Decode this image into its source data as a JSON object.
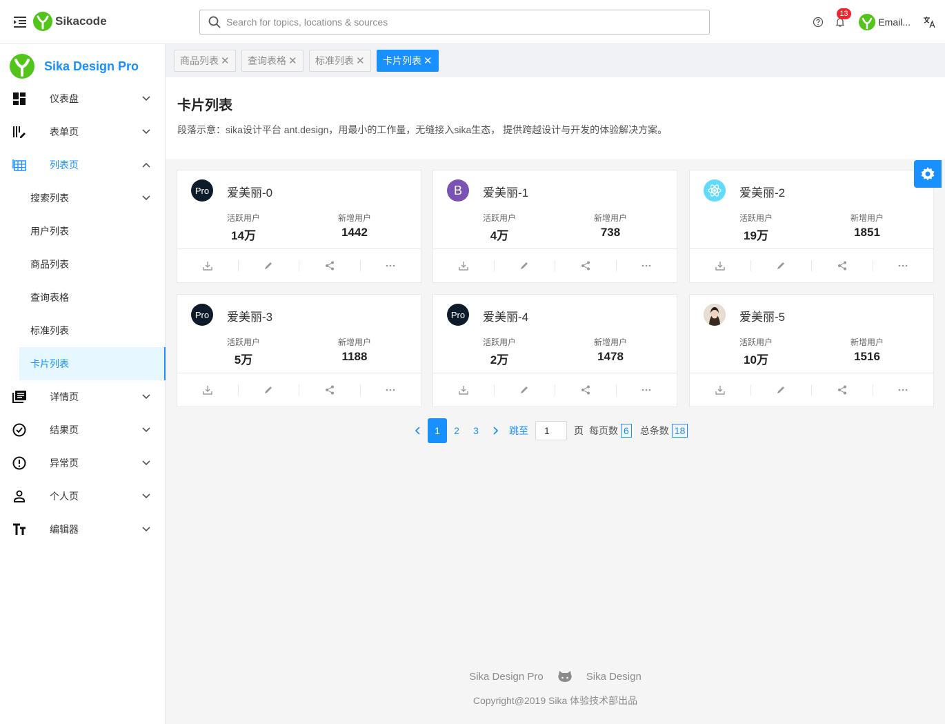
{
  "header": {
    "brand": "Sikacode",
    "search_placeholder": "Search for topics, locations & sources",
    "notification_count": "13",
    "user_name": "Email..."
  },
  "sidebar": {
    "title": "Sika Design Pro",
    "items": [
      {
        "label": "仪表盘",
        "icon": "dashboard-icon"
      },
      {
        "label": "表单页",
        "icon": "form-icon"
      },
      {
        "label": "列表页",
        "icon": "table-icon"
      },
      {
        "label": "详情页",
        "icon": "profile-icon"
      },
      {
        "label": "结果页",
        "icon": "check-circle-icon"
      },
      {
        "label": "异常页",
        "icon": "warning-icon"
      },
      {
        "label": "个人页",
        "icon": "user-icon"
      },
      {
        "label": "编辑器",
        "icon": "font-size-icon"
      }
    ],
    "sub_items": [
      {
        "label": "搜索列表"
      },
      {
        "label": "用户列表"
      },
      {
        "label": "商品列表"
      },
      {
        "label": "查询表格"
      },
      {
        "label": "标准列表"
      },
      {
        "label": "卡片列表"
      }
    ]
  },
  "tabs": [
    {
      "label": "商品列表"
    },
    {
      "label": "查询表格"
    },
    {
      "label": "标准列表"
    },
    {
      "label": "卡片列表"
    }
  ],
  "page": {
    "title": "卡片列表",
    "description": "段落示意：sika设计平台 ant.design，用最小的工作量，无缝接入sika生态， 提供跨越设计与开发的体验解决方案。"
  },
  "cards": [
    {
      "title": "爱美丽-0",
      "avatar": "Pro",
      "active_label": "活跃用户",
      "active": "14万",
      "new_label": "新增用户",
      "new": "1442"
    },
    {
      "title": "爱美丽-1",
      "avatar": "B",
      "active_label": "活跃用户",
      "active": "4万",
      "new_label": "新增用户",
      "new": "738"
    },
    {
      "title": "爱美丽-2",
      "avatar": "",
      "active_label": "活跃用户",
      "active": "19万",
      "new_label": "新增用户",
      "new": "1851"
    },
    {
      "title": "爱美丽-3",
      "avatar": "Pro",
      "active_label": "活跃用户",
      "active": "5万",
      "new_label": "新增用户",
      "new": "1188"
    },
    {
      "title": "爱美丽-4",
      "avatar": "Pro",
      "active_label": "活跃用户",
      "active": "2万",
      "new_label": "新增用户",
      "new": "1478"
    },
    {
      "title": "爱美丽-5",
      "avatar": "",
      "active_label": "活跃用户",
      "active": "10万",
      "new_label": "新增用户",
      "new": "1516"
    }
  ],
  "pagination": {
    "pages": [
      "1",
      "2",
      "3"
    ],
    "current": "1",
    "jump_label": "跳至",
    "jump_value": "1",
    "page_unit": "页",
    "page_size_label": "每页数",
    "page_size": "6",
    "total_label": "总条数",
    "total": "18"
  },
  "footer": {
    "link1": "Sika Design Pro",
    "link2": "Sika Design",
    "copyright": "Copyright@2019 Sika 体验技术部出品"
  },
  "colors": {
    "primary": "#1890ff",
    "badge": "#f5222d",
    "logo_green": "#52c41a"
  }
}
